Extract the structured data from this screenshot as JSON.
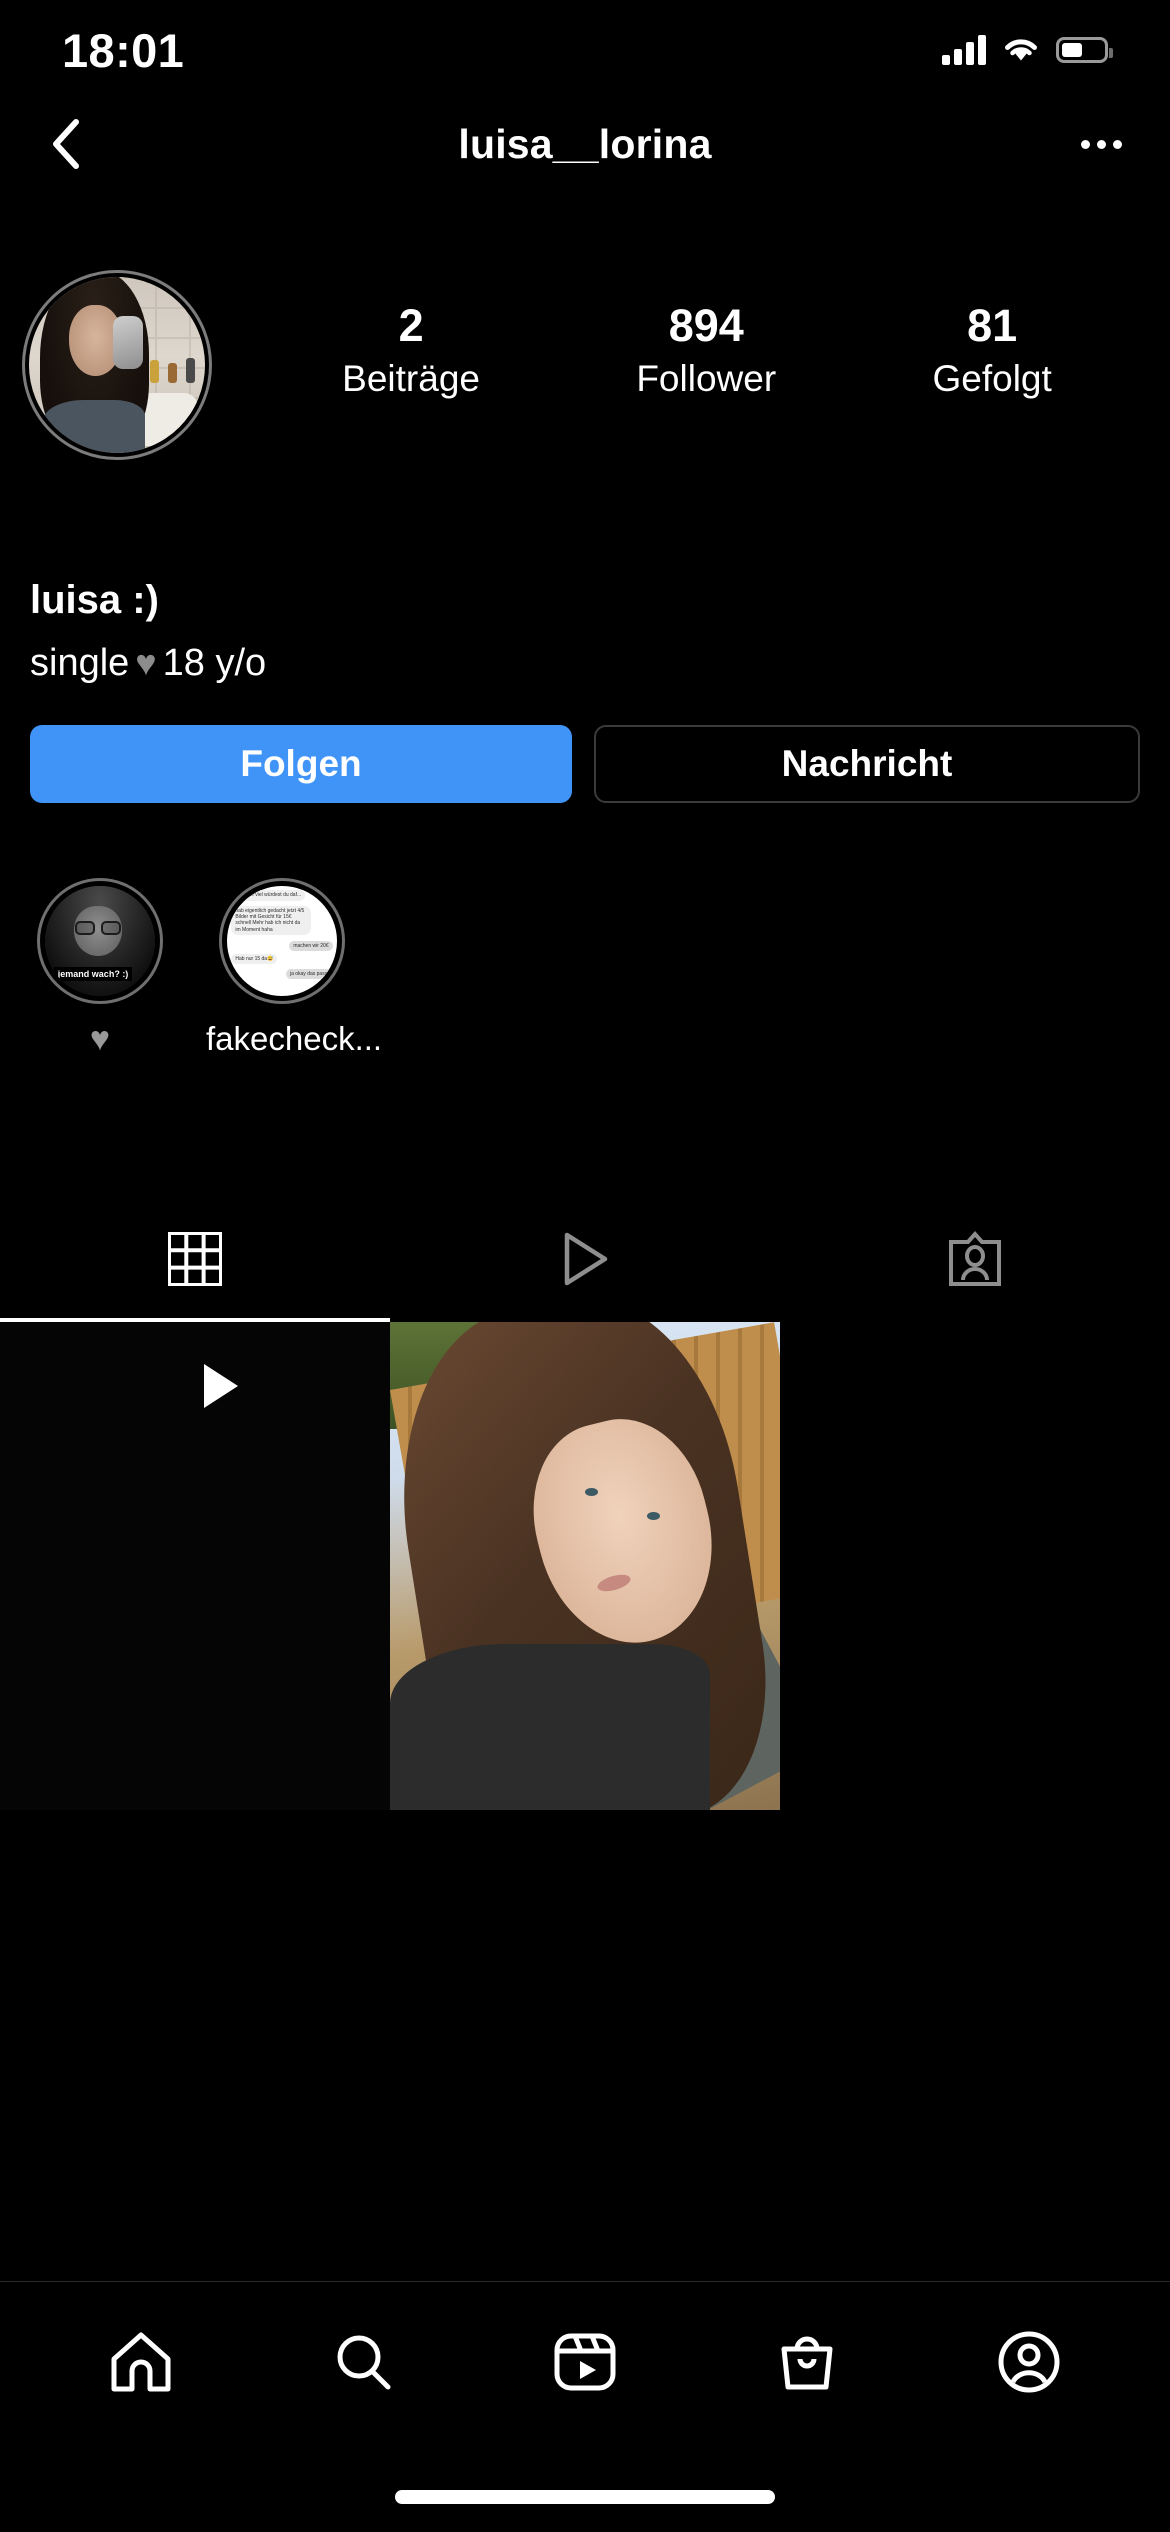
{
  "status_bar": {
    "time": "18:01",
    "signal_icon": "cellular-signal-icon",
    "wifi_icon": "wifi-icon",
    "battery_icon": "battery-icon",
    "battery_level_pct": 50
  },
  "header": {
    "back_icon": "back-chevron-icon",
    "username": "luisa__lorina",
    "more_icon": "more-options-icon"
  },
  "profile": {
    "avatar_alt": "bathroom-mirror-selfie",
    "display_name": "luisa :)",
    "bio_prefix": "single",
    "bio_emoji": "♥",
    "bio_suffix": "18 y/o",
    "stats": [
      {
        "value": "2",
        "label": "Beiträge"
      },
      {
        "value": "894",
        "label": "Follower"
      },
      {
        "value": "81",
        "label": "Gefolgt"
      }
    ]
  },
  "actions": {
    "follow_label": "Folgen",
    "message_label": "Nachricht",
    "follow_color": "#4093f7"
  },
  "highlights": [
    {
      "label": "♥",
      "is_emoji": true,
      "cover_alt": "black-and-white-selfie-with-glasses",
      "cover_caption": "jemand wach? :)"
    },
    {
      "label": "fakecheck...",
      "is_emoji": false,
      "cover_alt": "chat-screenshot",
      "chat_lines": [
        {
          "side": "in",
          "text": "wie viel würdest du daf..."
        },
        {
          "side": "in",
          "text": "hab eigentlich gedacht jetzt 4/5 Bilder mit Gesicht für 15€ schnell Mehr hab ich nicht da im Moment haha"
        },
        {
          "side": "out",
          "text": "machen wir 20€"
        },
        {
          "side": "in",
          "text": "Hab nur 15 da😅"
        },
        {
          "side": "out",
          "text": "ja okay das passt"
        }
      ]
    }
  ],
  "tabs": [
    {
      "name": "grid-tab",
      "icon": "grid-icon",
      "active": true
    },
    {
      "name": "reels-tab",
      "icon": "reels-play-icon",
      "active": false
    },
    {
      "name": "tagged-tab",
      "icon": "tagged-person-icon",
      "active": false
    }
  ],
  "posts": [
    {
      "type": "reel",
      "alt": "dark-video-thumbnail",
      "has_play_icon": true
    },
    {
      "type": "photo",
      "alt": "outdoor-selfie-by-wooden-fence",
      "has_play_icon": false
    }
  ],
  "bottom_nav": [
    {
      "name": "nav-home",
      "icon": "home-icon"
    },
    {
      "name": "nav-search",
      "icon": "search-icon"
    },
    {
      "name": "nav-reels",
      "icon": "reels-icon"
    },
    {
      "name": "nav-shop",
      "icon": "shopping-bag-icon"
    },
    {
      "name": "nav-profile",
      "icon": "profile-avatar-icon"
    }
  ]
}
